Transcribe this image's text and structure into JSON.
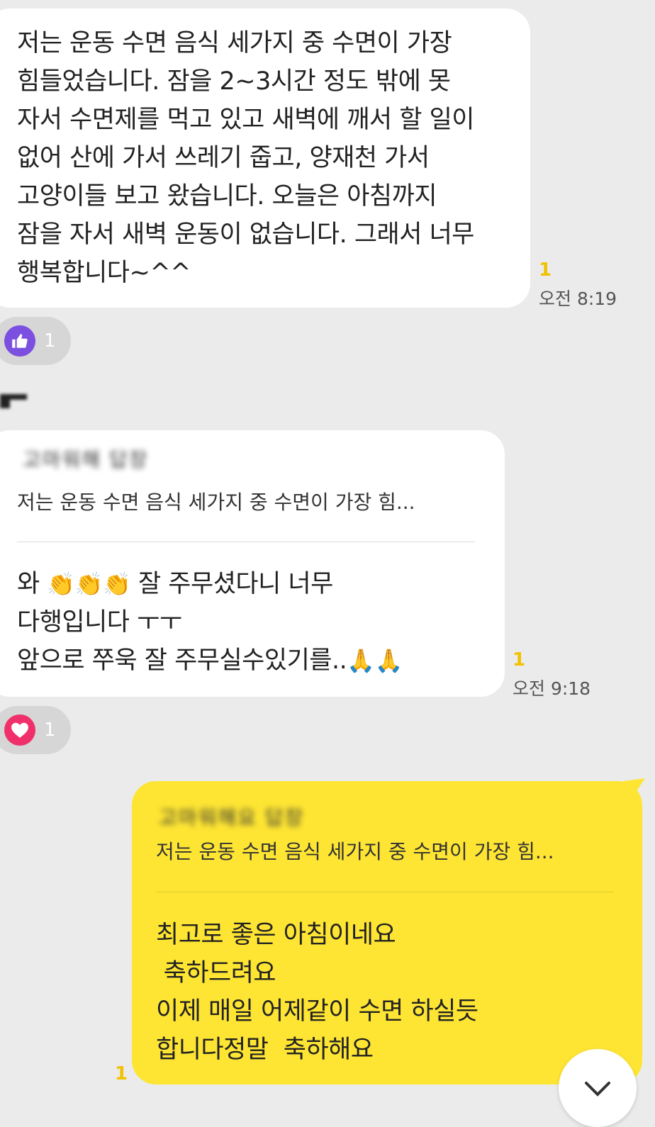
{
  "messages": [
    {
      "text": "저는 운동 수면 음식 세가지 중 수면이 가장\n힘들었습니다. 잠을 2~3시간 정도 밖에 못\n자서 수면제를 먹고 있고 새벽에 깨서 할 일이\n없어 산에 가서 쓰레기 줍고, 양재천 가서\n고양이들 보고 왔습니다. 오늘은 아침까지\n잠을 자서 새벽 운동이 없습니다. 그래서 너무\n행복합니다~^^",
      "unread": "1",
      "time": "오전 8:19",
      "reaction": {
        "icon": "thumbs-up-icon",
        "count": "1",
        "color": "#7b4fe0"
      }
    },
    {
      "quote_name": "고마워해 답장",
      "quote_text": "저는 운동 수면 음식 세가지 중 수면이 가장 힘...",
      "line1_prefix": "와 ",
      "clap": "👏👏👏",
      "line1_suffix": " 잘 주무셨다니 너무",
      "line2": "다행입니다 ㅜㅜ",
      "line3": "앞으로 쭈욱 잘 주무실수있기를..",
      "pray": "🙏🙏",
      "unread": "1",
      "time": "오전 9:18",
      "reaction": {
        "icon": "heart-icon",
        "count": "1",
        "color": "#f0306a"
      }
    },
    {
      "quote_name": "고마워해요 답장",
      "quote_text": "저는 운동 수면 음식 세가지 중 수면이 가장 힘...",
      "text": "최고로 좋은 아침이네요\n 축하드려요\n이제 매일 어제같이 수면 하실듯\n합니다정말  축하해요",
      "unread": "1"
    }
  ],
  "colors": {
    "incoming": "#ffffff",
    "outgoing": "#fee533",
    "background": "#ebebeb",
    "unread": "#f2c200"
  }
}
